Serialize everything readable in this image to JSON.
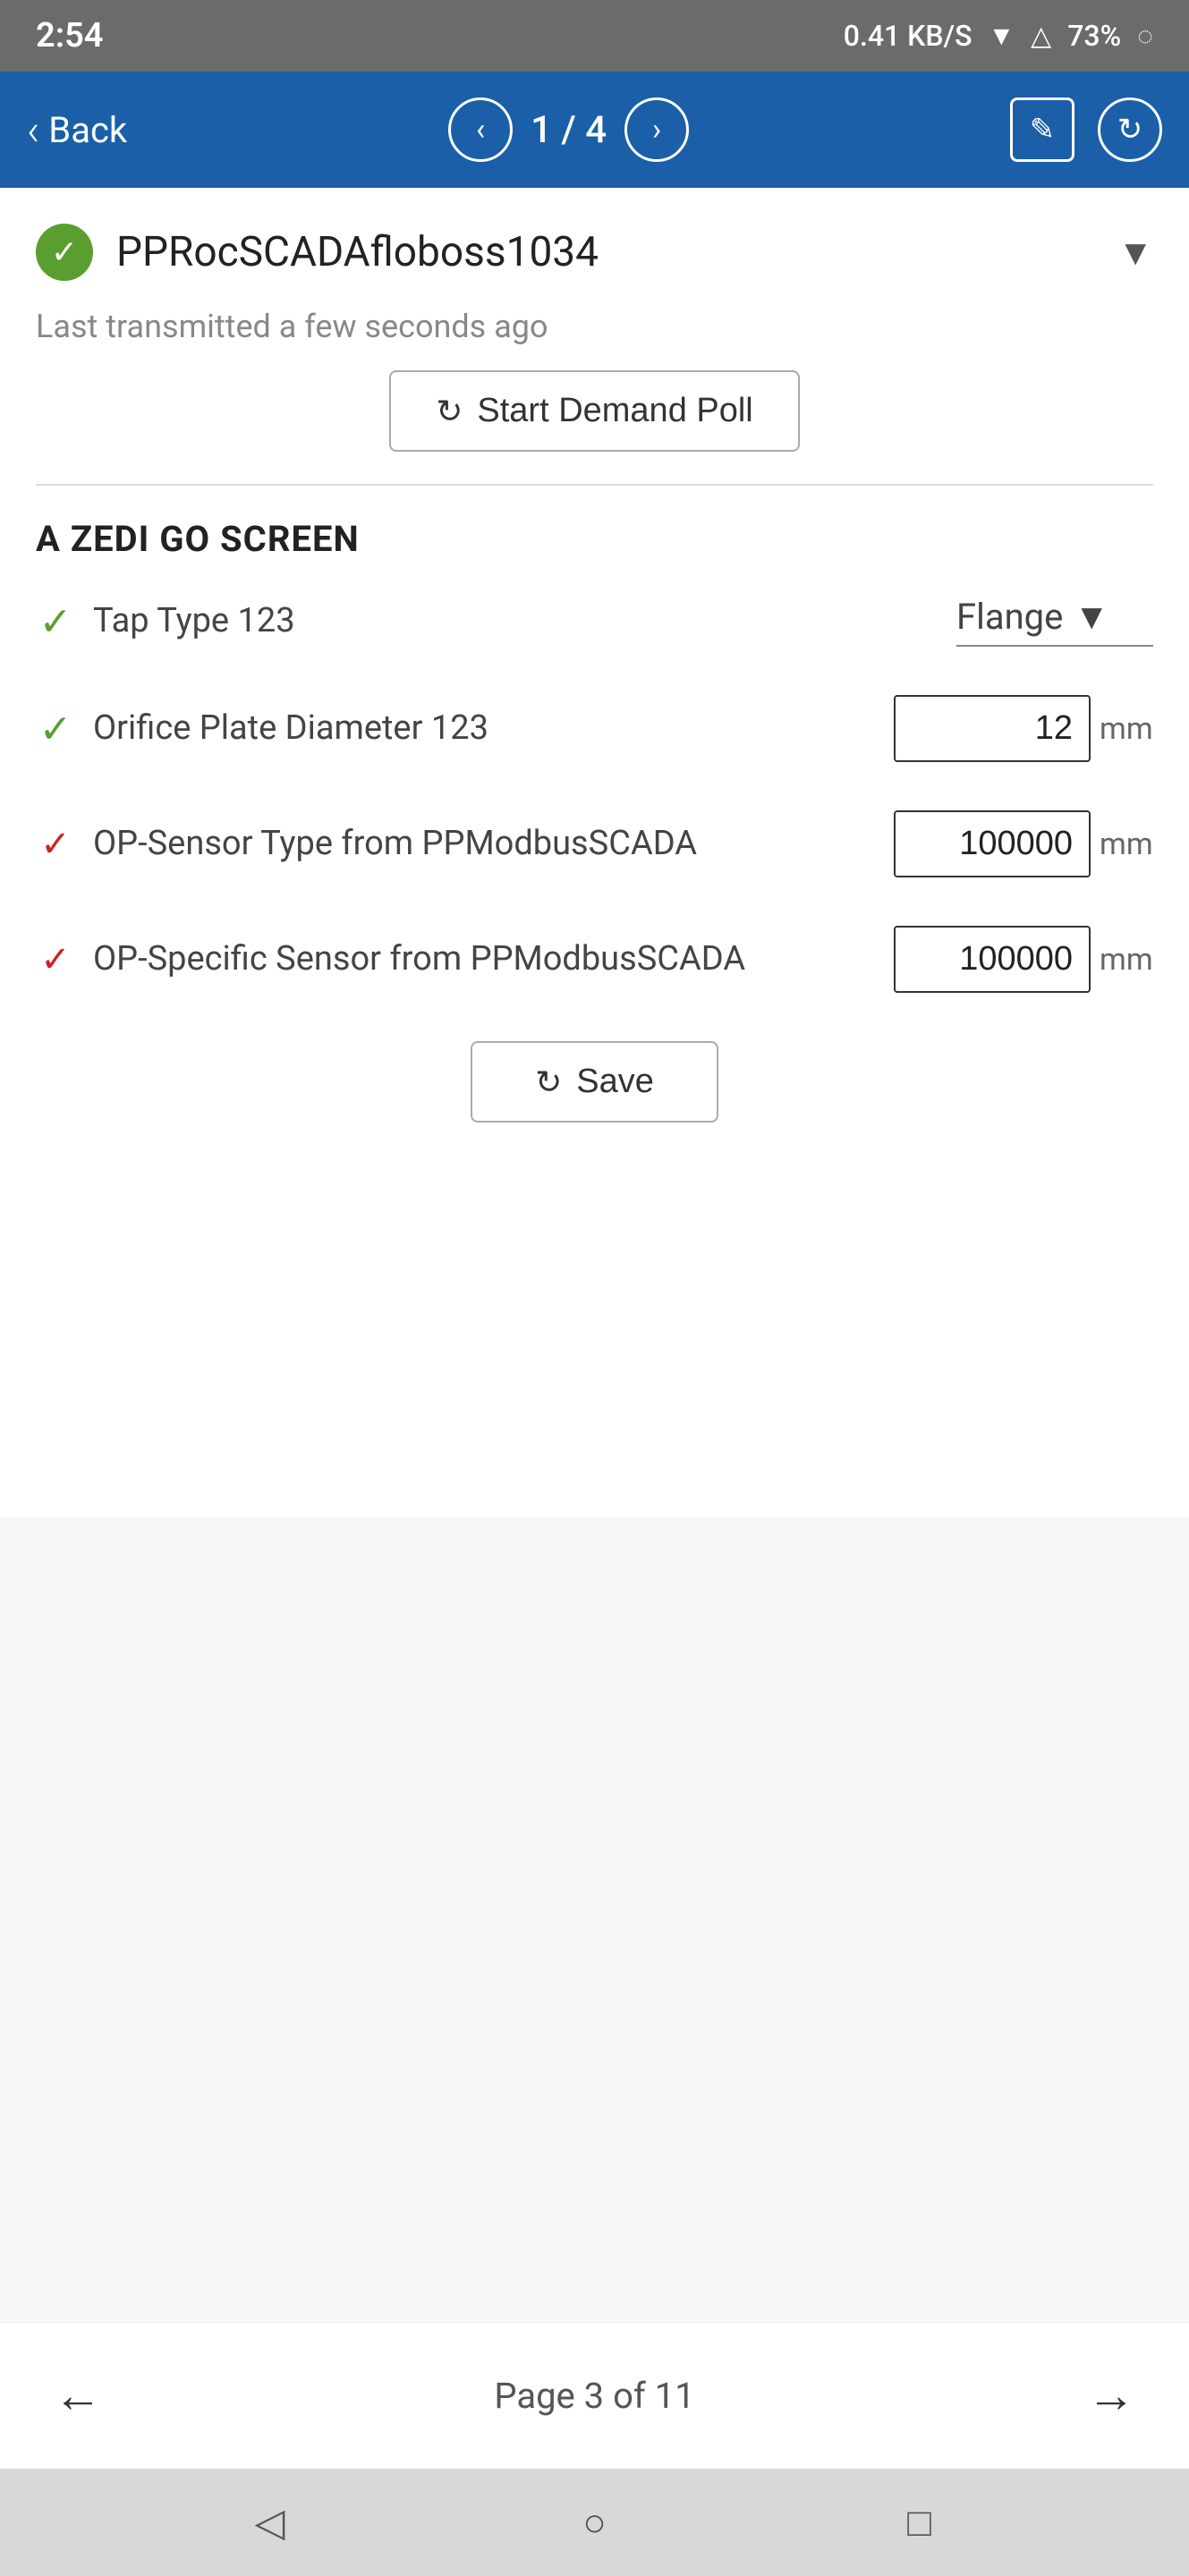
{
  "status_bar": {
    "time": "2:54",
    "network_speed": "0.41 KB/S",
    "battery_percent": "73%"
  },
  "nav_bar": {
    "back_label": "Back",
    "page_current": "1",
    "page_separator": "/",
    "page_total": "4"
  },
  "device": {
    "name": "PPRocSCADAfloboss1034",
    "status": "active",
    "transmission_text": "Last transmitted a few seconds ago",
    "demand_poll_label": "Start Demand Poll"
  },
  "section": {
    "title": "A ZEDI GO SCREEN"
  },
  "fields": [
    {
      "id": "tap-type",
      "label": "Tap Type 123",
      "indicator": "green-check",
      "value_type": "dropdown",
      "value": "Flange"
    },
    {
      "id": "orifice-plate-diameter",
      "label": "Orifice Plate Diameter 123",
      "indicator": "green-check",
      "value_type": "input",
      "value": "12",
      "unit": "mm"
    },
    {
      "id": "op-sensor-type",
      "label": "OP-Sensor Type from PPModbusSCADA",
      "indicator": "red-check",
      "value_type": "input",
      "value": "100000",
      "unit": "mm"
    },
    {
      "id": "op-specific-sensor",
      "label": "OP-Specific Sensor from PPModbusSCADA",
      "indicator": "red-check",
      "value_type": "input",
      "value": "100000",
      "unit": "mm"
    }
  ],
  "save_button_label": "Save",
  "pagination": {
    "text": "Page 3 of 11"
  },
  "bottom_nav": {
    "back_icon": "◁",
    "home_icon": "○",
    "recent_icon": "□"
  }
}
